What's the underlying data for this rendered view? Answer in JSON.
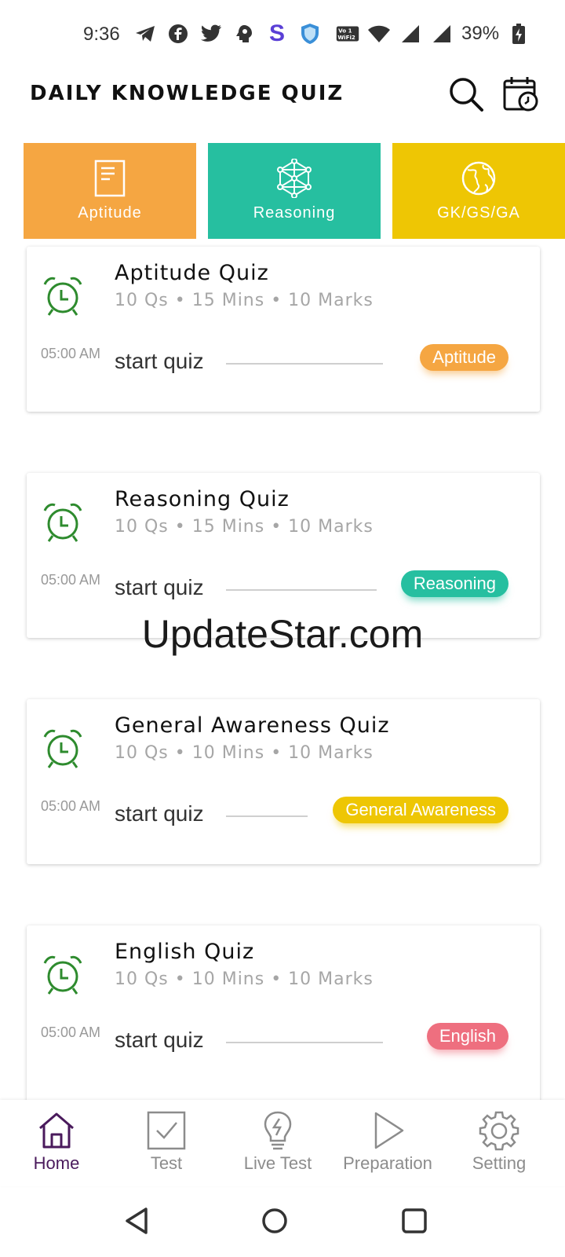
{
  "status_bar": {
    "time": "9:36",
    "battery_percent": "39%",
    "notification_icons": [
      "telegram-icon",
      "facebook-icon",
      "twitter-icon",
      "brain-app-icon",
      "s-app-icon",
      "shield-app-icon"
    ]
  },
  "app_bar": {
    "title": "DAILY KNOWLEDGE QUIZ"
  },
  "categories": [
    {
      "label": "Aptitude",
      "color": "#F5A642",
      "icon": "document-icon"
    },
    {
      "label": "Reasoning",
      "color": "#26BFA0",
      "icon": "network-icon"
    },
    {
      "label": "GK/GS/GA",
      "color": "#EEC604",
      "icon": "globe-icon"
    }
  ],
  "quizzes": [
    {
      "title": "Aptitude Quiz",
      "meta": "10 Qs • 15 Mins • 10 Marks",
      "time": "05:00 AM",
      "action": "start quiz",
      "tag": "Aptitude",
      "tag_color": "#F5A642"
    },
    {
      "title": "Reasoning Quiz",
      "meta": "10 Qs • 15 Mins • 10 Marks",
      "time": "05:00 AM",
      "action": "start quiz",
      "tag": "Reasoning",
      "tag_color": "#26BFA0"
    },
    {
      "title": "General Awareness Quiz",
      "meta": "10 Qs • 10 Mins • 10 Marks",
      "time": "05:00 AM",
      "action": "start quiz",
      "tag": "General Awareness",
      "tag_color": "#EEC604"
    },
    {
      "title": "English Quiz",
      "meta": "10 Qs • 10 Mins • 10 Marks",
      "time": "05:00 AM",
      "action": "start quiz",
      "tag": "English",
      "tag_color": "#EE6F7F"
    }
  ],
  "watermark": "UpdateStar.com",
  "bottom_nav": [
    {
      "label": "Home",
      "icon": "home-icon",
      "active": true
    },
    {
      "label": "Test",
      "icon": "checkbox-icon",
      "active": false
    },
    {
      "label": "Live Test",
      "icon": "lightbulb-icon",
      "active": false
    },
    {
      "label": "Preparation",
      "icon": "play-icon",
      "active": false
    },
    {
      "label": "Setting",
      "icon": "gear-icon",
      "active": false
    }
  ],
  "colors": {
    "clock_green": "#2E8B2E",
    "nav_active": "#4A1A5C",
    "nav_inactive": "#8C8C8C"
  }
}
